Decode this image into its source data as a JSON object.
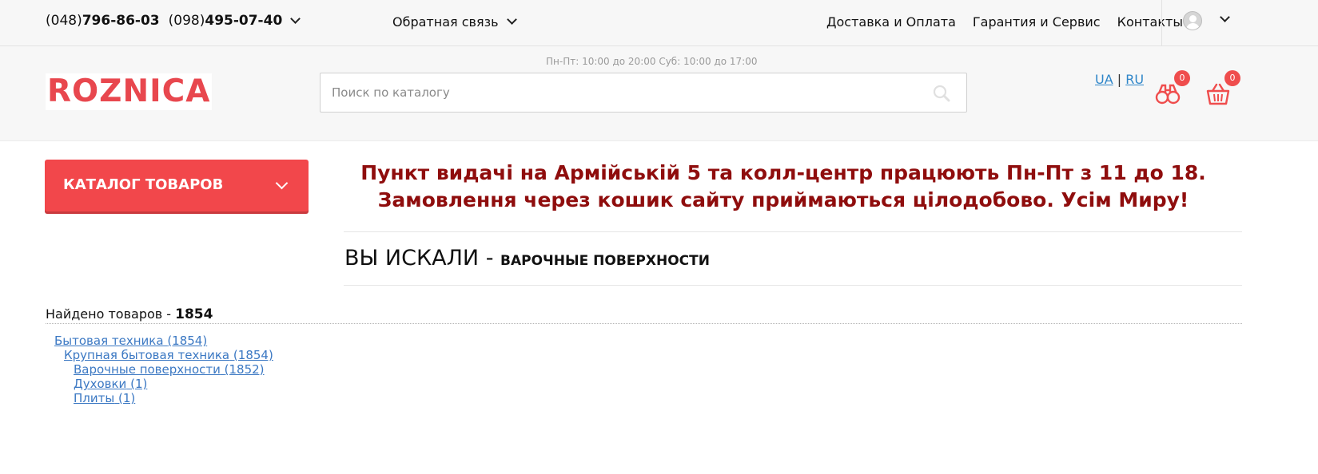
{
  "topbar": {
    "phone1_code": "(048)",
    "phone1_number": "796-86-03",
    "phone2_code": "(098)",
    "phone2_number": "495-07-40",
    "feedback_label": "Обратная связь",
    "nav": [
      "Доставка и Оплата",
      "Гарантия и Сервис",
      "Контакты"
    ]
  },
  "header": {
    "logo": "ROZNICA",
    "hours": "Пн-Пт: 10:00 до 20:00 Суб: 10:00 до 17:00",
    "search_placeholder": "Поиск по каталогу",
    "lang_ua": "UA",
    "lang_sep": "|",
    "lang_ru": "RU",
    "compare_count": "0",
    "cart_count": "0"
  },
  "catalog": {
    "label": "КАТАЛОГ ТОВАРОВ"
  },
  "announcement": {
    "line1": "Пункт видачі на Армійській 5 та колл-центр працюють Пн-Пт з 11 до 18.",
    "line2": "Замовлення через кошик сайту приймаються цілодобово. Усім Миру!"
  },
  "search_result": {
    "title_prefix": "ВЫ ИСКАЛИ - ",
    "query": "ВАРОЧНЫЕ ПОВЕРХНОСТИ",
    "found_label": "Найдено товаров - ",
    "found_count": "1854"
  },
  "categories": [
    {
      "name": "Бытовая техника",
      "count": "(1854)"
    },
    {
      "name": "Крупная бытовая техника",
      "count": "(1854)"
    },
    {
      "name": "Варочные поверхности",
      "count": "(1852)"
    },
    {
      "name": "Духовки",
      "count": "(1)"
    },
    {
      "name": "Плиты",
      "count": "(1)"
    }
  ],
  "colors": {
    "accent": "#f2474b",
    "announcement": "#8f0d0d",
    "link": "#3b78c3"
  },
  "icons": [
    "chevron-down-icon",
    "user-avatar-icon",
    "search-icon",
    "compare-binoculars-icon",
    "cart-basket-icon"
  ]
}
